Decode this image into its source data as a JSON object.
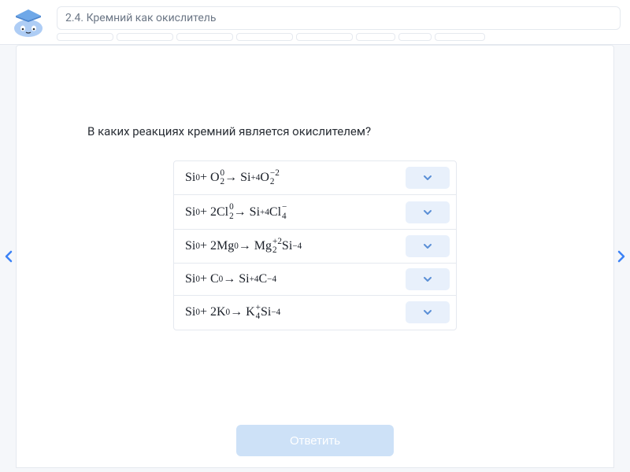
{
  "header": {
    "title": "2.4. Кремний как окислитель",
    "progress_segments": [
      72,
      72,
      72,
      72,
      72,
      50,
      42,
      64
    ]
  },
  "question": "В каких реакциях кремний является окислителем?",
  "reactions": [
    {
      "html": "Si<sup>0</sup> + O<span class='ss'><span>0</span><span>2</span></span> → Si<sup>+4</sup>O<span class='ss'><span>−2</span><span>2</span></span>"
    },
    {
      "html": "Si<sup>0</sup> + 2Cl<span class='ss'><span>0</span><span>2</span></span> → Si<sup>+4</sup>Cl<span class='ss'><span>−</span><span>4</span></span>"
    },
    {
      "html": "Si<sup>0</sup> + 2Mg<sup>0</sup> → Mg<span class='ss'><span>+2</span><span>2</span></span>Si<sup>−4</sup>"
    },
    {
      "html": "Si<sup>0</sup> + C<sup>0</sup> → Si<sup>+4</sup>C<sup>−4</sup>"
    },
    {
      "html": "Si<sup>0</sup> + 2K<sup>0</sup> → K<span class='ss'><span>+</span><span>4</span></span>Si<sup>−4</sup>"
    }
  ],
  "submit_label": "Ответить"
}
